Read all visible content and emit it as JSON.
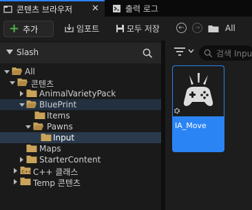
{
  "tabs": [
    {
      "label": "콘텐츠 브라우저",
      "icon": "content-browser-icon",
      "active": true
    },
    {
      "label": "출력 로그",
      "icon": "output-log-icon",
      "active": false
    }
  ],
  "toolbar": {
    "add_label": "추가",
    "import_label": "임포트",
    "save_all_label": "모두 저장",
    "path_label": "All"
  },
  "sources": {
    "title": "Slash"
  },
  "tree": [
    {
      "label": "All",
      "depth": 0,
      "state": "expanded"
    },
    {
      "label": "콘텐츠",
      "depth": 1,
      "state": "expanded"
    },
    {
      "label": "AnimalVarietyPack",
      "depth": 2,
      "state": "collapsed"
    },
    {
      "label": "BluePrint",
      "depth": 2,
      "state": "expanded"
    },
    {
      "label": "Items",
      "depth": 3,
      "state": "leaf"
    },
    {
      "label": "Pawns",
      "depth": 3,
      "state": "expanded"
    },
    {
      "label": "Input",
      "depth": 4,
      "state": "leaf"
    },
    {
      "label": "Maps",
      "depth": 2,
      "state": "leaf"
    },
    {
      "label": "StarterContent",
      "depth": 2,
      "state": "collapsed"
    },
    {
      "label": "C++ 클래스",
      "depth": 1,
      "state": "collapsed"
    },
    {
      "label": "Temp 콘텐츠",
      "depth": 1,
      "state": "collapsed"
    }
  ],
  "search": {
    "placeholder": "검색 Input"
  },
  "assets": [
    {
      "name": "IA_Move",
      "icon": "gamepad-icon"
    }
  ],
  "colors": {
    "accent": "#2b84f4",
    "folder": "#c9a35a",
    "add_plus": "#51b24a"
  }
}
